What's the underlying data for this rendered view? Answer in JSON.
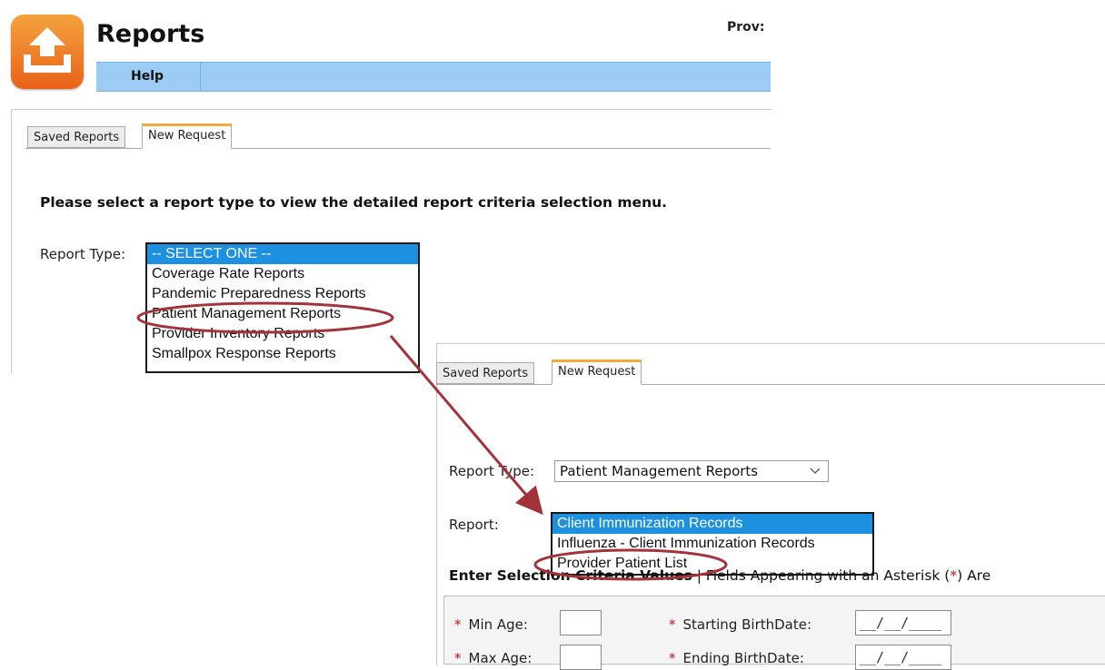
{
  "header": {
    "title": "Reports",
    "provider_label": "Prov:",
    "help_label": "Help"
  },
  "panel1": {
    "tabs": [
      {
        "label": "Saved Reports",
        "active": false
      },
      {
        "label": "New Request",
        "active": true
      }
    ],
    "instruction": "Please select a report type to view the detailed report criteria selection menu.",
    "report_type_label": "Report Type:",
    "report_type_options": [
      "-- SELECT ONE --",
      "Coverage Rate Reports",
      "Pandemic Preparedness Reports",
      "Patient Management Reports",
      "Provider Inventory Reports",
      "Smallpox Response Reports"
    ],
    "selected_index": 0,
    "highlighted_option": "Patient Management Reports"
  },
  "panel2": {
    "tabs": [
      {
        "label": "Saved Reports",
        "active": false
      },
      {
        "label": "New Request",
        "active": true
      }
    ],
    "report_type_label": "Report Type:",
    "report_type_value": "Patient Management Reports",
    "report_label": "Report:",
    "report_options": [
      "Client Immunization Records",
      "Influenza - Client Immunization Records",
      "Provider Patient List"
    ],
    "selected_index": 0,
    "highlighted_option": "Provider Patient List",
    "criteria_heading_bold": "Enter Selection Criteria Values",
    "criteria_heading_rest": "| Fields Appearing with an Asterisk (",
    "criteria_heading_star": "*",
    "criteria_heading_tail": ") Are",
    "fields": {
      "min_age_label": "Min Age:",
      "max_age_label": "Max Age:",
      "start_birthdate_label": "Starting BirthDate:",
      "end_birthdate_label": "Ending BirthDate:",
      "start_birthdate_value": "__/__/____",
      "end_birthdate_value": "__/__/____",
      "required_marker": "*"
    }
  },
  "colors": {
    "accent_blue": "#9ccbf3",
    "selected_option": "#1e90e0",
    "active_tab_top": "#f3a93c",
    "annotation_red": "#a3333a",
    "logo_orange": "#ee7a22",
    "required_star": "#d01010"
  },
  "icons": {
    "logo": "upload-tray-icon",
    "dropdown": "chevron-down-icon"
  }
}
